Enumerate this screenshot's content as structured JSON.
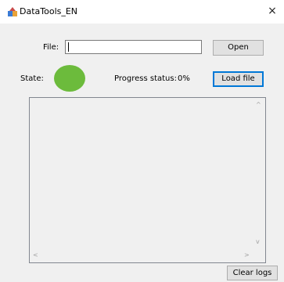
{
  "window": {
    "title": "DataTools_EN",
    "close_glyph": "×",
    "app_icon": "app-icon"
  },
  "file_row": {
    "label": "File:",
    "value": "",
    "open_label": "Open"
  },
  "state_row": {
    "state_label": "State:",
    "state_color": "#6cbb3c",
    "progress_label": "Progress status:",
    "progress_value": "0%",
    "load_label": "Load file"
  },
  "log": {
    "content": "",
    "up_arrow": "^",
    "down_arrow": "v",
    "left_arrow": "<",
    "right_arrow": ">"
  },
  "footer": {
    "clear_label": "Clear logs"
  }
}
